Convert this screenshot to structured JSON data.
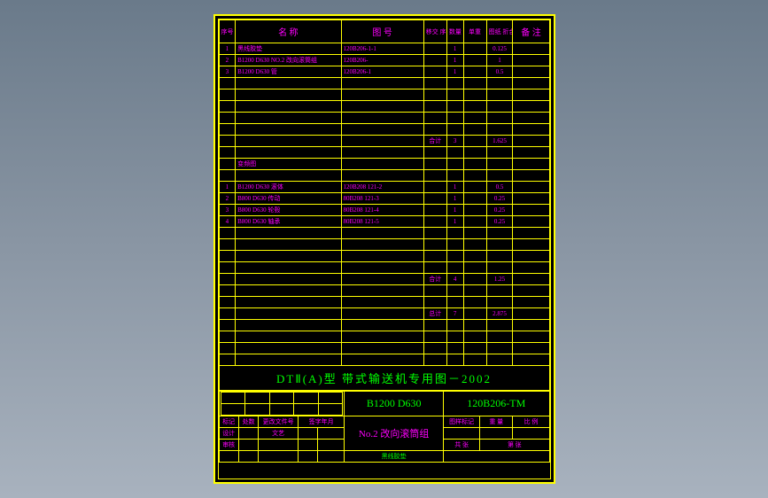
{
  "header": {
    "seq": "序号",
    "name": "名  称",
    "drawno": "图  号",
    "transno": "移交\n序号",
    "qty": "数量",
    "singlewt": "单重",
    "totalwt": "图纸\n折合(t)",
    "remark": "备  注"
  },
  "rows_a": [
    {
      "n": "1",
      "name": "黑线胶垫",
      "dw": "120B206-1-1",
      "t": "",
      "q": "1",
      "w": "0.125",
      "r": ""
    },
    {
      "n": "2",
      "name": "B1200 D630 NO.2 改向滚筒组",
      "dw": "120B206-",
      "t": "",
      "q": "1",
      "w": "1",
      "r": ""
    },
    {
      "n": "3",
      "name": "B1200 D630 管",
      "dw": "120B206-1",
      "t": "",
      "q": "1",
      "w": "0.5",
      "r": ""
    }
  ],
  "subtotal_a": {
    "label": "合计",
    "q": "3",
    "w": "1.625"
  },
  "note_a": "变频图",
  "rows_b": [
    {
      "n": "1",
      "name": "B1200 D630 滚体",
      "dw": "120B208 121-2",
      "t": "",
      "q": "1",
      "w": "0.5",
      "r": ""
    },
    {
      "n": "2",
      "name": "B800 D630 传动",
      "dw": "80B208 121-3",
      "t": "",
      "q": "1",
      "w": "0.25",
      "r": ""
    },
    {
      "n": "3",
      "name": "B800 D630 轮毂",
      "dw": "80B208 121-4",
      "t": "",
      "q": "1",
      "w": "0.25",
      "r": ""
    },
    {
      "n": "4",
      "name": "B800 D630 轴承",
      "dw": "80B208 121-5",
      "t": "",
      "q": "1",
      "w": "0.25",
      "r": ""
    }
  ],
  "subtotal_b": {
    "label": "合计",
    "q": "4",
    "w": "1.25"
  },
  "grandtotal": {
    "label": "总计",
    "q": "7",
    "w": "2.875"
  },
  "title_main": "DTⅡ(A)型  带式输送机专用图－2002",
  "titleblock": {
    "spec": "B1200  D630",
    "code": "120B206-TM",
    "part": "No.2 改向滚筒组",
    "note": "黑线胶垫",
    "r1c1": "标记",
    "r1c2": "处数",
    "r1c3": "更改文件号",
    "r1c4": "签字年月",
    "r2c1": "设计",
    "r2c3": "文艺",
    "r3c1": "审核",
    "tr1": "图样标记",
    "tr2": "重 量",
    "tr3": "比 例",
    "br1": "共  张",
    "br2": "第  张"
  }
}
